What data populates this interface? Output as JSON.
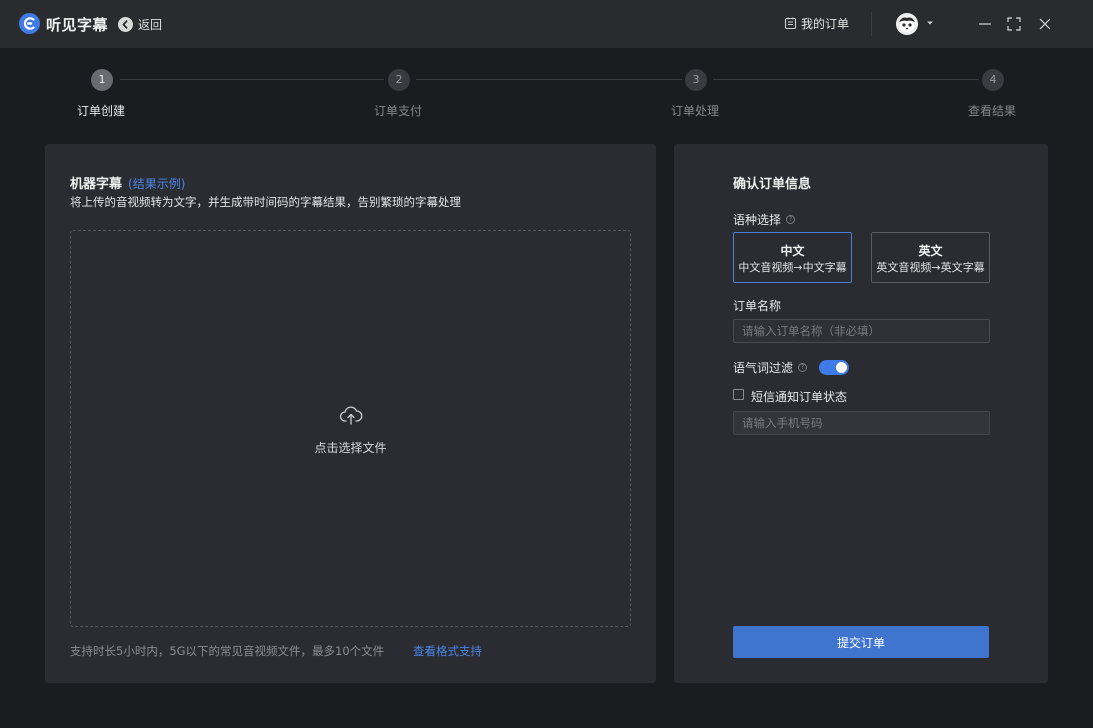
{
  "app": {
    "title": "听见字幕",
    "back_label": "返回"
  },
  "header": {
    "orders_label": "我的订单"
  },
  "steps": [
    {
      "number": "1",
      "label": "订单创建",
      "active": true
    },
    {
      "number": "2",
      "label": "订单支付",
      "active": false
    },
    {
      "number": "3",
      "label": "订单处理",
      "active": false
    },
    {
      "number": "4",
      "label": "查看结果",
      "active": false
    }
  ],
  "machine_subtitle": {
    "title": "机器字幕",
    "example_link": "(结果示例)",
    "description": "将上传的音视频转为文字，并生成带时间码的字幕结果，告别繁琐的字幕处理",
    "upload_label": "点击选择文件",
    "footer_note": "支持时长5小时内，5G以下的常见音视频文件，最多10个文件",
    "format_link": "查看格式支持"
  },
  "order_info": {
    "title": "确认订单信息",
    "language_label": "语种选择",
    "languages": [
      {
        "name": "中文",
        "desc": "中文音视频→中文字幕",
        "selected": true
      },
      {
        "name": "英文",
        "desc": "英文音视频→英文字幕",
        "selected": false
      }
    ],
    "order_name_label": "订单名称",
    "order_name_placeholder": "请输入订单名称（非必填）",
    "filter_label": "语气词过滤",
    "filter_on": true,
    "sms_label": "短信通知订单状态",
    "sms_checked": false,
    "phone_placeholder": "请输入手机号码",
    "submit_label": "提交订单"
  },
  "colors": {
    "accent": "#3f7be6",
    "link": "#4a86e8",
    "background": "#1b1c1f",
    "panel": "#2b2c31"
  }
}
